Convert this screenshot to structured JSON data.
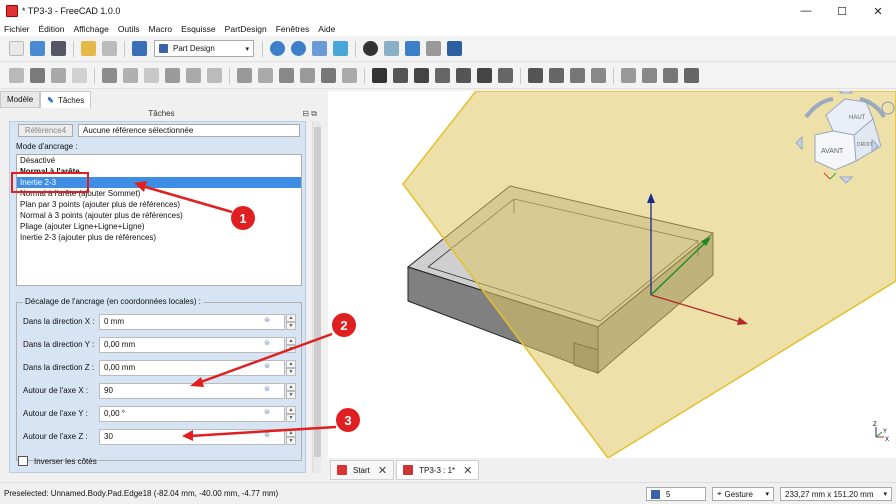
{
  "window": {
    "title": "* TP3-3 - FreeCAD 1.0.0",
    "minimize": "—",
    "maximize": "☐",
    "close": "✕"
  },
  "menu": [
    "Fichier",
    "Édition",
    "Affichage",
    "Outils",
    "Macro",
    "Esquisse",
    "PartDesign",
    "Fenêtres",
    "Aide"
  ],
  "toolbar": {
    "workbench": "Part Design"
  },
  "panel": {
    "tabs": {
      "model": "Modèle",
      "tasks": "Tâches"
    },
    "header": "Tâches",
    "reference_button": "Référence4",
    "reference_value": "Aucune référence sélectionnée",
    "attachment_label": "Mode d'ancrage :",
    "modes": [
      {
        "label": "Désactivé",
        "style": "normal"
      },
      {
        "label": "Normal à l'arête",
        "style": "bold"
      },
      {
        "label": "Inertie 2-3",
        "style": "selected"
      },
      {
        "label": "Normal à l'arête (ajouter Sommet)",
        "style": "normal"
      },
      {
        "label": "Plan par 3 points (ajouter plus de références)",
        "style": "normal"
      },
      {
        "label": "Normal à 3 points (ajouter plus de références)",
        "style": "normal"
      },
      {
        "label": "Pliage (ajouter Ligne+Ligne+Ligne)",
        "style": "normal"
      },
      {
        "label": "Inertie 2-3 (ajouter plus de références)",
        "style": "normal"
      }
    ],
    "offset_group": "Décalage de l'ancrage (en coordonnées locales) :",
    "offsets": [
      {
        "label": "Dans la direction X :",
        "value": "0 mm"
      },
      {
        "label": "Dans la direction Y :",
        "value": "0,00 mm"
      },
      {
        "label": "Dans la direction Z :",
        "value": "0,00 mm"
      },
      {
        "label": "Autour de l'axe X :",
        "value": "90"
      },
      {
        "label": "Autour de l'axe Y :",
        "value": "0,00 °"
      },
      {
        "label": "Autour de l'axe Z :",
        "value": "30"
      }
    ],
    "flip_label": "Inverser les côtés"
  },
  "navcube": {
    "top": "HAUT",
    "front": "AVANT",
    "right": "DROITE"
  },
  "axes": {
    "x": "X",
    "y": "Y",
    "z": "Z"
  },
  "annotations": [
    "1",
    "2",
    "3"
  ],
  "doc_tabs": [
    {
      "label": "Start",
      "close": "✕"
    },
    {
      "label": "TP3-3 : 1*",
      "close": "✕"
    }
  ],
  "status": {
    "preselected": "Preselected: Unnamed.Body.Pad.Edge18 (-82.04 mm, -40.00 mm, -4.77 mm)",
    "count": "5",
    "navigation": "Gesture",
    "dimensions": "233,27 mm x 151,20 mm"
  },
  "colors": {
    "accent": "#3e8ee6",
    "arrow": "#e02020",
    "plane": "#e0c763"
  }
}
